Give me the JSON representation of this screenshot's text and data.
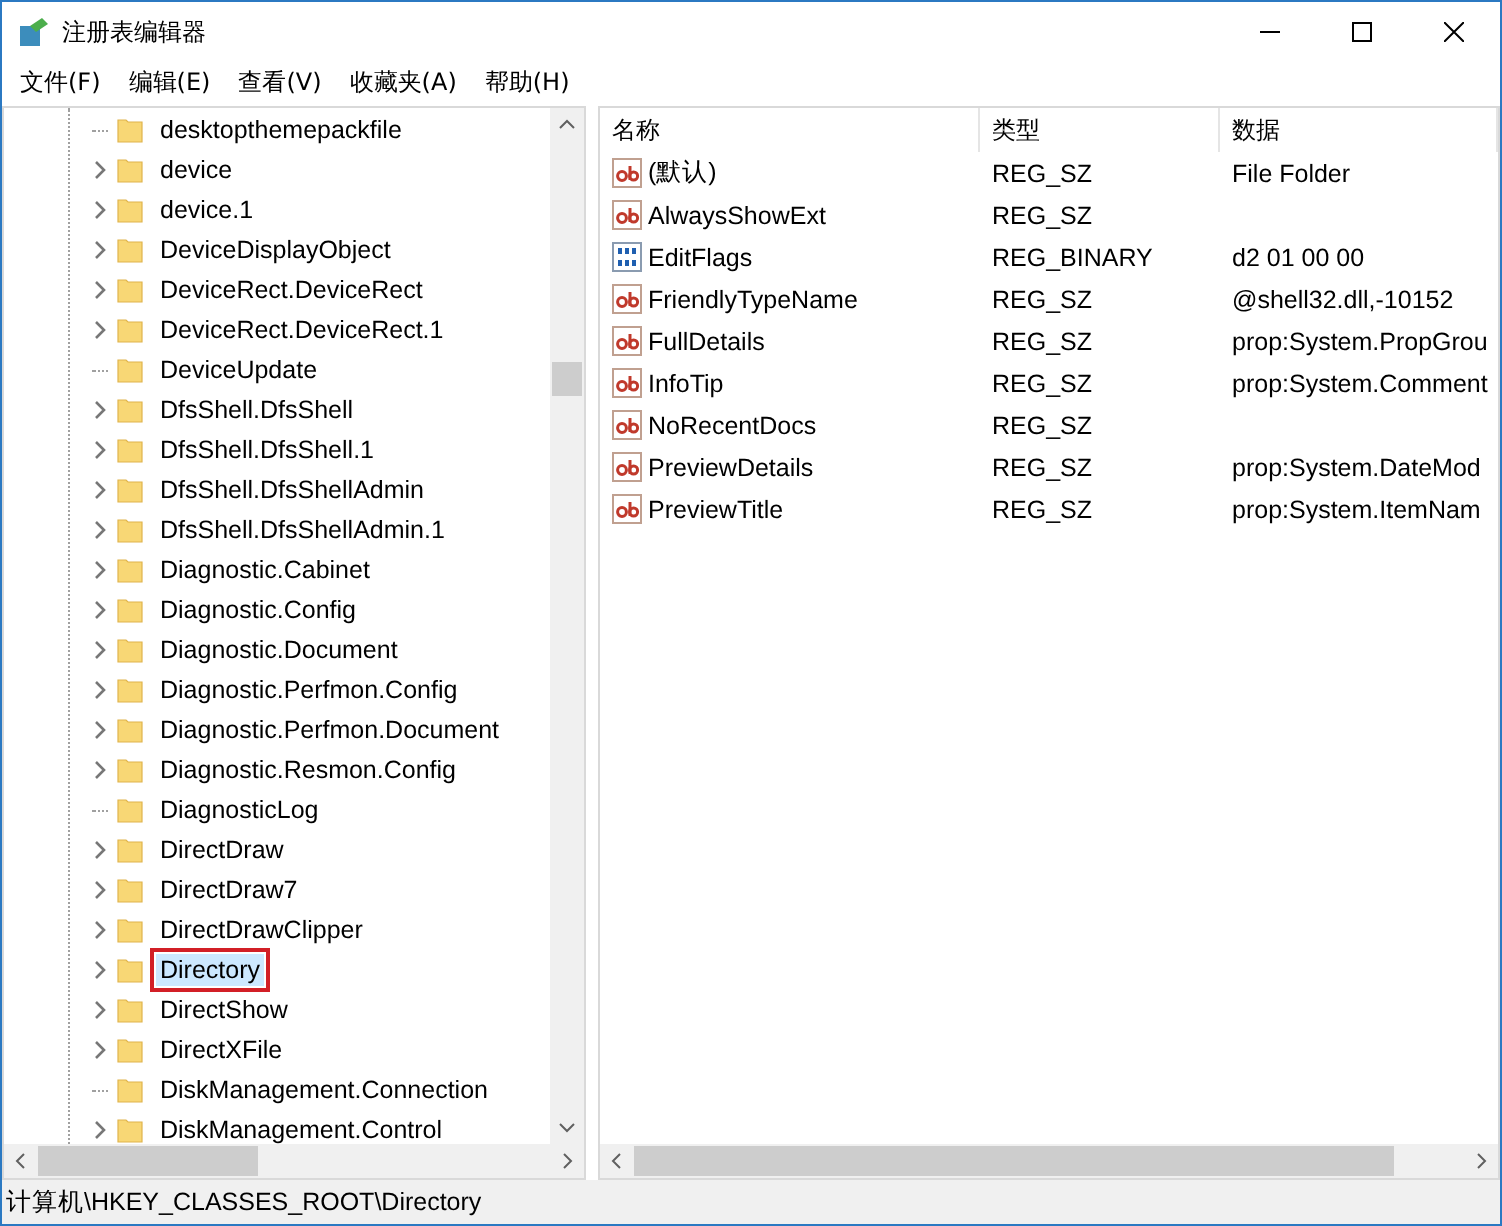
{
  "window": {
    "title": "注册表编辑器"
  },
  "menu": [
    "文件(F)",
    "编辑(E)",
    "查看(V)",
    "收藏夹(A)",
    "帮助(H)"
  ],
  "tree": {
    "items": [
      {
        "label": "desktopthemepackfile",
        "expandable": false,
        "selected": false
      },
      {
        "label": "device",
        "expandable": true,
        "selected": false
      },
      {
        "label": "device.1",
        "expandable": true,
        "selected": false
      },
      {
        "label": "DeviceDisplayObject",
        "expandable": true,
        "selected": false
      },
      {
        "label": "DeviceRect.DeviceRect",
        "expandable": true,
        "selected": false
      },
      {
        "label": "DeviceRect.DeviceRect.1",
        "expandable": true,
        "selected": false
      },
      {
        "label": "DeviceUpdate",
        "expandable": false,
        "selected": false
      },
      {
        "label": "DfsShell.DfsShell",
        "expandable": true,
        "selected": false
      },
      {
        "label": "DfsShell.DfsShell.1",
        "expandable": true,
        "selected": false
      },
      {
        "label": "DfsShell.DfsShellAdmin",
        "expandable": true,
        "selected": false
      },
      {
        "label": "DfsShell.DfsShellAdmin.1",
        "expandable": true,
        "selected": false
      },
      {
        "label": "Diagnostic.Cabinet",
        "expandable": true,
        "selected": false
      },
      {
        "label": "Diagnostic.Config",
        "expandable": true,
        "selected": false
      },
      {
        "label": "Diagnostic.Document",
        "expandable": true,
        "selected": false
      },
      {
        "label": "Diagnostic.Perfmon.Config",
        "expandable": true,
        "selected": false
      },
      {
        "label": "Diagnostic.Perfmon.Document",
        "expandable": true,
        "selected": false
      },
      {
        "label": "Diagnostic.Resmon.Config",
        "expandable": true,
        "selected": false
      },
      {
        "label": "DiagnosticLog",
        "expandable": false,
        "selected": false
      },
      {
        "label": "DirectDraw",
        "expandable": true,
        "selected": false
      },
      {
        "label": "DirectDraw7",
        "expandable": true,
        "selected": false
      },
      {
        "label": "DirectDrawClipper",
        "expandable": true,
        "selected": false
      },
      {
        "label": "Directory",
        "expandable": true,
        "selected": true
      },
      {
        "label": "DirectShow",
        "expandable": true,
        "selected": false
      },
      {
        "label": "DirectXFile",
        "expandable": true,
        "selected": false
      },
      {
        "label": "DiskManagement.Connection",
        "expandable": false,
        "selected": false
      },
      {
        "label": "DiskManagement.Control",
        "expandable": true,
        "selected": false
      }
    ]
  },
  "values": {
    "columns": [
      "名称",
      "类型",
      "数据"
    ],
    "rows": [
      {
        "kind": "string",
        "name": "(默认)",
        "type": "REG_SZ",
        "data": "File Folder"
      },
      {
        "kind": "string",
        "name": "AlwaysShowExt",
        "type": "REG_SZ",
        "data": ""
      },
      {
        "kind": "binary",
        "name": "EditFlags",
        "type": "REG_BINARY",
        "data": "d2 01 00 00"
      },
      {
        "kind": "string",
        "name": "FriendlyTypeName",
        "type": "REG_SZ",
        "data": "@shell32.dll,-10152"
      },
      {
        "kind": "string",
        "name": "FullDetails",
        "type": "REG_SZ",
        "data": "prop:System.PropGrou"
      },
      {
        "kind": "string",
        "name": "InfoTip",
        "type": "REG_SZ",
        "data": "prop:System.Comment"
      },
      {
        "kind": "string",
        "name": "NoRecentDocs",
        "type": "REG_SZ",
        "data": ""
      },
      {
        "kind": "string",
        "name": "PreviewDetails",
        "type": "REG_SZ",
        "data": "prop:System.DateMod"
      },
      {
        "kind": "string",
        "name": "PreviewTitle",
        "type": "REG_SZ",
        "data": "prop:System.ItemNam"
      }
    ]
  },
  "status_bar": "计算机\\HKEY_CLASSES_ROOT\\Directory"
}
